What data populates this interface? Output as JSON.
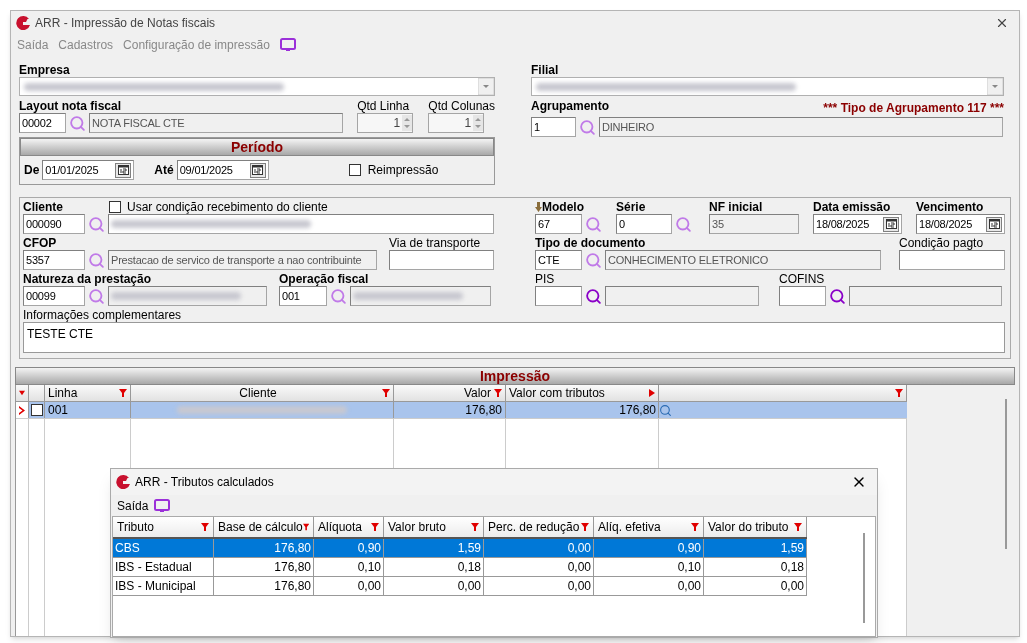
{
  "window": {
    "title": "ARR - Impressão de Notas fiscais"
  },
  "menu": [
    "Saída",
    "Cadastros",
    "Configuração de impressão"
  ],
  "empresa": {
    "label": "Empresa"
  },
  "filial": {
    "label": "Filial"
  },
  "layout": {
    "label": "Layout nota fiscal",
    "code": "00002",
    "description": "NOTA FISCAL CTE"
  },
  "qtd_linha": {
    "label": "Qtd Linha",
    "value": "1"
  },
  "qtd_colunas": {
    "label": "Qtd Colunas",
    "value": "1"
  },
  "agrupamento": {
    "label": "Agrupamento",
    "notice": "*** Tipo de Agrupamento 117 ***",
    "code": "1",
    "description": "DINHEIRO"
  },
  "periodo": {
    "title": "Período",
    "from_label": "De",
    "from": "01/01/2025",
    "to_label": "Até",
    "to": "09/01/2025",
    "reprint": {
      "label": "Reimpressão",
      "checked": false
    }
  },
  "cliente": {
    "label": "Cliente",
    "code": "000090",
    "use_condition": {
      "label": "Usar condição recebimento do cliente",
      "checked": false
    }
  },
  "cfop": {
    "label": "CFOP",
    "code": "5357",
    "description": "Prestacao de servico de transporte a nao contribuinte"
  },
  "via_transporte": {
    "label": "Via de transporte"
  },
  "natureza": {
    "label": "Natureza da prestação",
    "code": "00099"
  },
  "operacao_fiscal": {
    "label": "Operação fiscal",
    "code": "001"
  },
  "informacoes": {
    "label": "Informações complementares",
    "value": "TESTE CTE"
  },
  "modelo": {
    "label": "Modelo",
    "value": "67"
  },
  "serie": {
    "label": "Série",
    "value": "0"
  },
  "nf_inicial": {
    "label": "NF inicial",
    "value": "35"
  },
  "data_emissao": {
    "label": "Data emissão",
    "value": "18/08/2025"
  },
  "vencimento": {
    "label": "Vencimento",
    "value": "18/08/2025"
  },
  "tipo_documento": {
    "label": "Tipo de documento",
    "code": "CTE",
    "description": "CONHECIMENTO ELETRONICO"
  },
  "condicao_pagto": {
    "label": "Condição pagto"
  },
  "pis": {
    "label": "PIS"
  },
  "cofins": {
    "label": "COFINS"
  },
  "impressao": {
    "title": "Impressão",
    "columns": [
      "Linha",
      "Cliente",
      "Valor",
      "Valor com tributos"
    ],
    "rows": [
      {
        "linha": "001",
        "valor": "176,80",
        "valor_com_tributos": "176,80",
        "checked": false,
        "selected": true
      }
    ]
  },
  "dialog": {
    "title": "ARR - Tributos calculados",
    "menu": [
      "Saída"
    ],
    "columns": [
      "Tributo",
      "Base de cálculo",
      "Alíquota",
      "Valor bruto",
      "Perc. de redução",
      "Alíq. efetiva",
      "Valor do tributo"
    ],
    "rows": [
      {
        "cells": [
          "CBS",
          "176,80",
          "0,90",
          "1,59",
          "0,00",
          "0,90",
          "1,59"
        ],
        "selected": true
      },
      {
        "cells": [
          "IBS - Estadual",
          "176,80",
          "0,10",
          "0,18",
          "0,00",
          "0,10",
          "0,18"
        ],
        "selected": false
      },
      {
        "cells": [
          "IBS - Municipal",
          "176,80",
          "0,00",
          "0,00",
          "0,00",
          "0,00",
          "0,00"
        ],
        "selected": false
      }
    ]
  }
}
